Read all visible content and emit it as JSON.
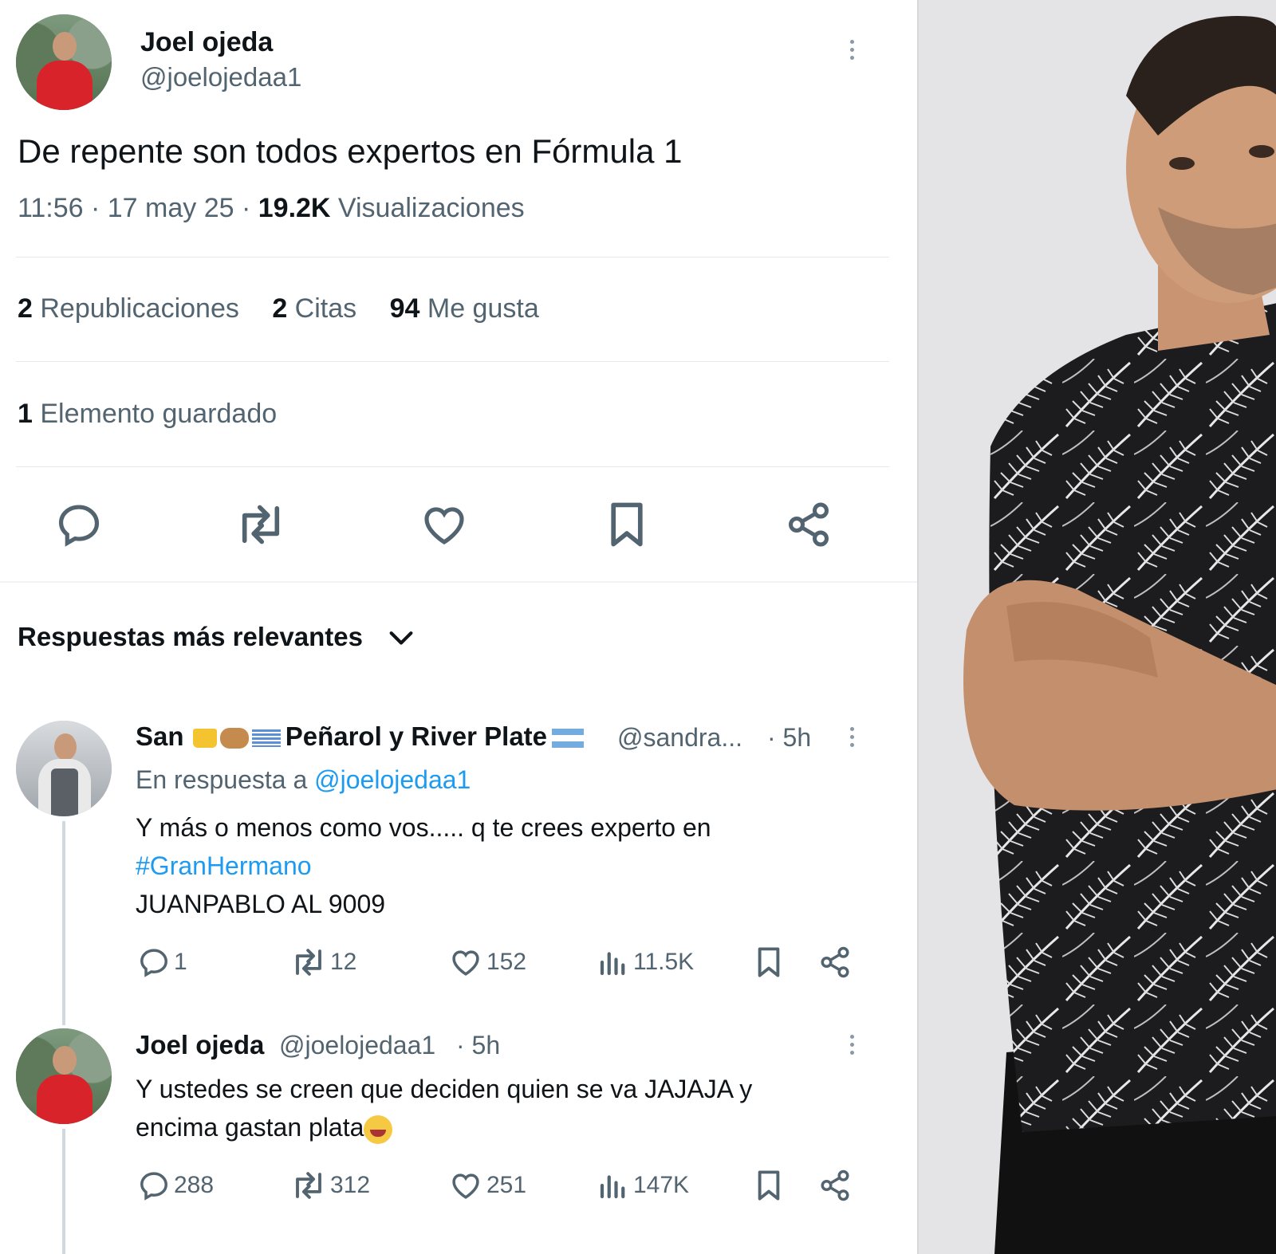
{
  "tweet": {
    "author_name": "Joel ojeda",
    "author_handle": "@joelojedaa1",
    "text": "De repente son todos expertos en Fórmula 1",
    "time": "11:56 · 17 may 25 · ",
    "views_count": "19.2K",
    "views_label": " Visualizaciones",
    "reposts_count": "2",
    "reposts_label": " Republicaciones",
    "quotes_count": "2",
    "quotes_label": " Citas",
    "likes_count": "94",
    "likes_label": " Me gusta",
    "saved_count": "1",
    "saved_label": " Elemento guardado"
  },
  "replies_header": "Respuestas más relevantes",
  "replies": [
    {
      "name_start": "San",
      "name_mid": "Peñarol y River Plate",
      "handle": "@sandra...",
      "time": "· 5h",
      "reply_to_label": "En respuesta a ",
      "reply_to_handle": "@joelojedaa1",
      "line1": "Y más o menos como vos..... q te crees experto en",
      "hashtag": "#GranHermano",
      "line3": "JUANPABLO AL 9009",
      "comments": "1",
      "reposts": "12",
      "likes": "152",
      "views": "11.5K"
    },
    {
      "name": "Joel ojeda",
      "handle": "@joelojedaa1",
      "time": "· 5h",
      "line1": "Y ustedes se creen que deciden quien se va JAJAJA y",
      "line2": "encima gastan plata",
      "comments": "288",
      "reposts": "312",
      "likes": "251",
      "views": "147K"
    }
  ],
  "colors": {
    "text": "#0f1419",
    "secondary": "#536471",
    "link": "#1d9bf0",
    "divider": "#e6e9eb"
  }
}
